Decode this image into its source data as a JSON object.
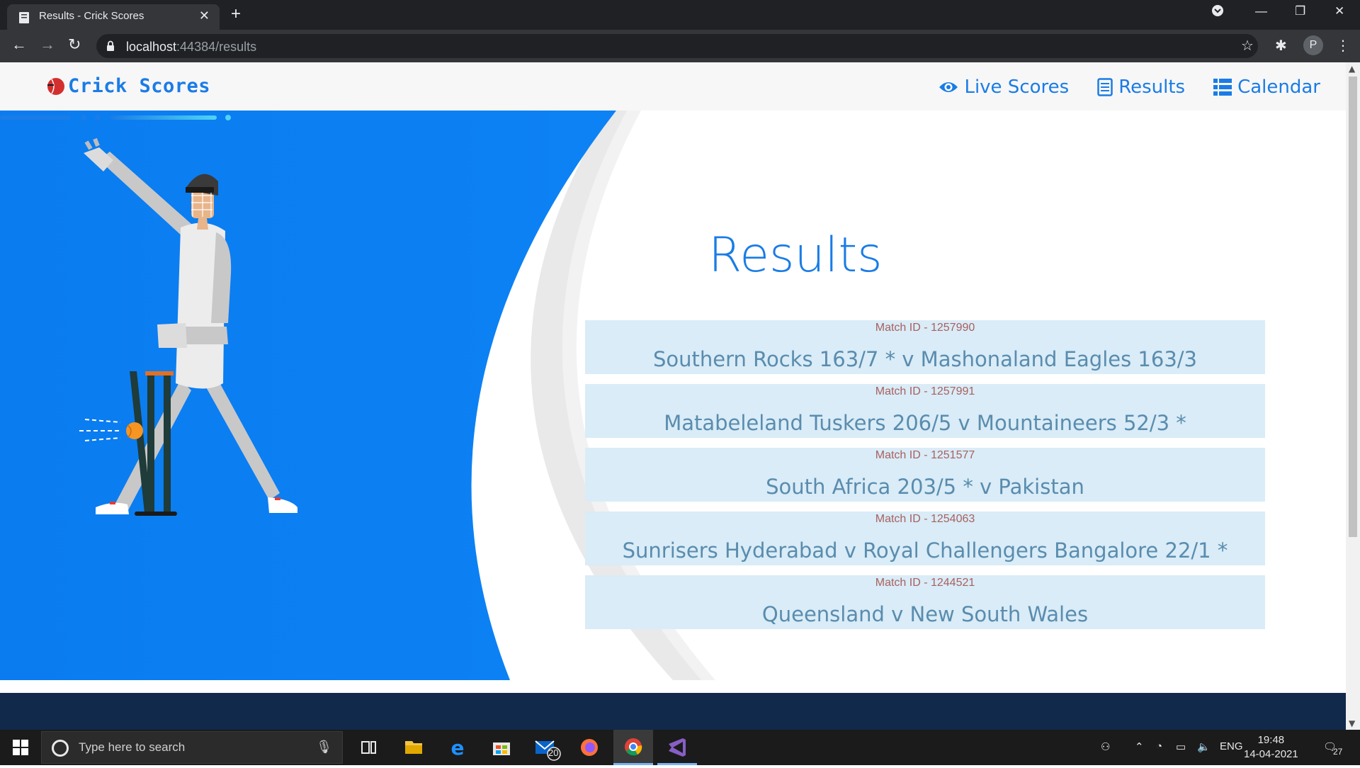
{
  "browser": {
    "tab_title": "Results - Crick Scores",
    "new_tab": "+",
    "url_host": "localhost",
    "url_rest": ":44384/results",
    "profile_initial": "P"
  },
  "site": {
    "logo_text": "Crick Scores",
    "nav": {
      "live": "Live Scores",
      "results": "Results",
      "calendar": "Calendar"
    },
    "page_title": "Results",
    "matches": [
      {
        "id_label": "Match ID - 1257990",
        "score": "Southern Rocks 163/7 * v Mashonaland Eagles 163/3"
      },
      {
        "id_label": "Match ID - 1257991",
        "score": "Matabeleland Tuskers 206/5 v Mountaineers 52/3 *"
      },
      {
        "id_label": "Match ID - 1251577",
        "score": "South Africa 203/5 * v Pakistan"
      },
      {
        "id_label": "Match ID - 1254063",
        "score": "Sunrisers Hyderabad v Royal Challengers Bangalore 22/1 *"
      },
      {
        "id_label": "Match ID - 1244521",
        "score": "Queensland v New South Wales"
      }
    ],
    "colors": {
      "accent": "#1a7ce6",
      "hero_blue": "#0d80f2",
      "card_bg": "#d9ecf7",
      "footer": "#11294a"
    }
  },
  "taskbar": {
    "search_placeholder": "Type here to search",
    "mail_badge": "20",
    "lang": "ENG",
    "time": "19:48",
    "date": "14-04-2021",
    "notif_count": "27"
  }
}
